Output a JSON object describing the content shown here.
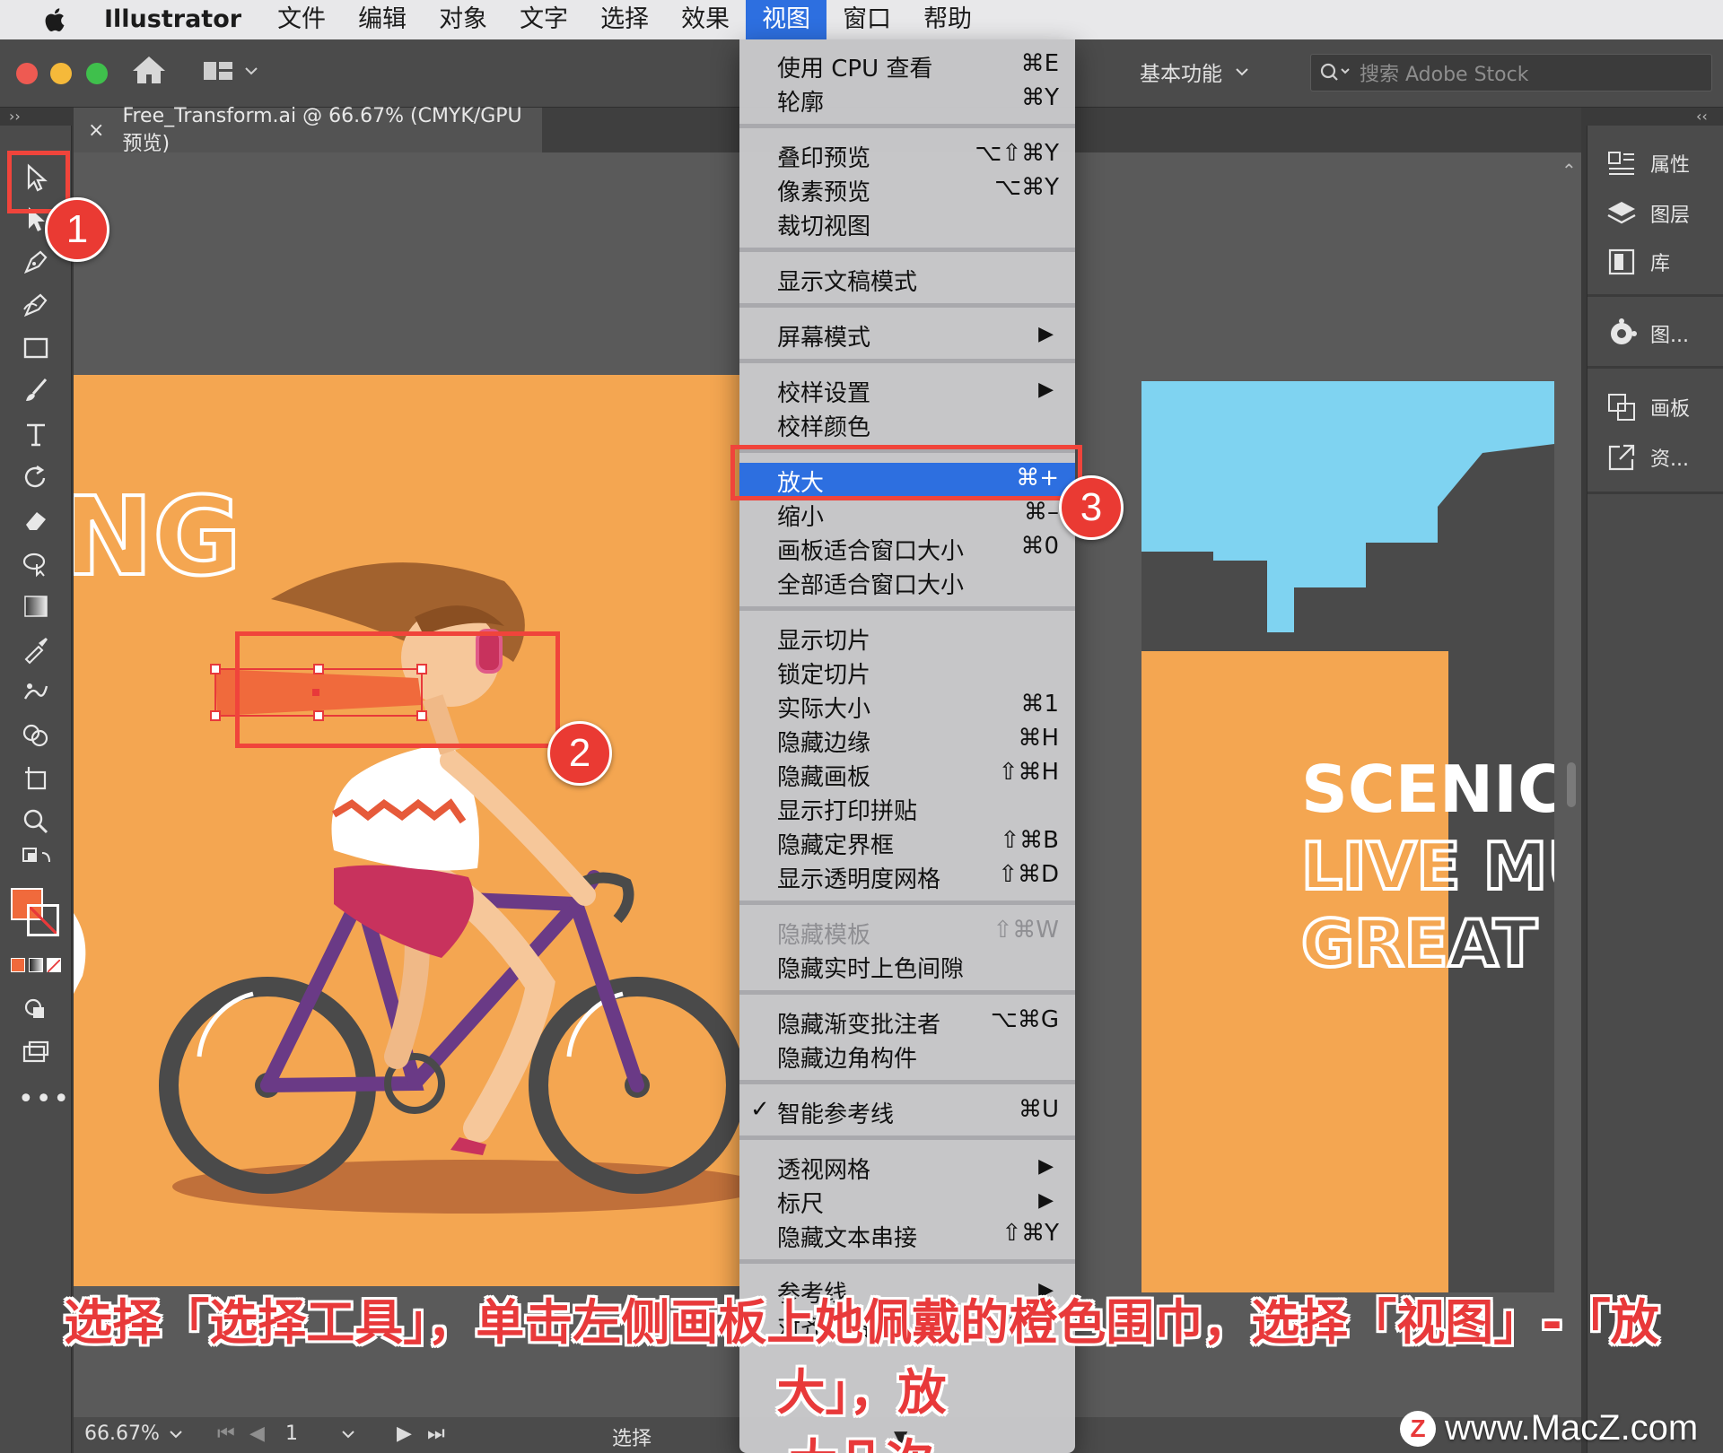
{
  "menubar": {
    "app": "Illustrator",
    "items": [
      "文件",
      "编辑",
      "对象",
      "文字",
      "选择",
      "效果",
      "视图",
      "窗口",
      "帮助"
    ],
    "active": "视图"
  },
  "appbar": {
    "workspace": "基本功能",
    "search_placeholder": "搜索 Adobe Stock"
  },
  "document_tab": {
    "close": "×",
    "title": "Free_Transform.ai @ 66.67% (CMYK/GPU 预览)"
  },
  "view_menu": [
    {
      "label": "使用 CPU 查看",
      "shortcut": "⌘E"
    },
    {
      "label": "轮廓",
      "shortcut": "⌘Y"
    },
    {
      "sep": true
    },
    {
      "label": "叠印预览",
      "shortcut": "⌥⇧⌘Y"
    },
    {
      "label": "像素预览",
      "shortcut": "⌥⌘Y"
    },
    {
      "label": "裁切视图",
      "shortcut": ""
    },
    {
      "sep": true
    },
    {
      "label": "显示文稿模式",
      "shortcut": ""
    },
    {
      "sep": true
    },
    {
      "label": "屏幕模式",
      "shortcut": "",
      "submenu": true
    },
    {
      "sep": true
    },
    {
      "label": "校样设置",
      "shortcut": "",
      "submenu": true
    },
    {
      "label": "校样颜色",
      "shortcut": ""
    },
    {
      "sep": true
    },
    {
      "label": "放大",
      "shortcut": "⌘+",
      "highlight": true
    },
    {
      "label": "缩小",
      "shortcut": "⌘–"
    },
    {
      "label": "画板适合窗口大小",
      "shortcut": "⌘0"
    },
    {
      "label": "全部适合窗口大小",
      "shortcut": ""
    },
    {
      "sep": true
    },
    {
      "label": "显示切片",
      "shortcut": ""
    },
    {
      "label": "锁定切片",
      "shortcut": ""
    },
    {
      "label": "实际大小",
      "shortcut": "⌘1"
    },
    {
      "label": "隐藏边缘",
      "shortcut": "⌘H"
    },
    {
      "label": "隐藏画板",
      "shortcut": "⇧⌘H"
    },
    {
      "label": "显示打印拼贴",
      "shortcut": ""
    },
    {
      "label": "隐藏定界框",
      "shortcut": "⇧⌘B"
    },
    {
      "label": "显示透明度网格",
      "shortcut": "⇧⌘D"
    },
    {
      "sep": true
    },
    {
      "label": "隐藏模板",
      "shortcut": "⇧⌘W",
      "disabled": true
    },
    {
      "label": "隐藏实时上色间隙",
      "shortcut": ""
    },
    {
      "sep": true
    },
    {
      "label": "隐藏渐变批注者",
      "shortcut": "⌥⌘G"
    },
    {
      "label": "隐藏边角构件",
      "shortcut": ""
    },
    {
      "sep": true
    },
    {
      "label": "智能参考线",
      "shortcut": "⌘U",
      "checked": true
    },
    {
      "sep": true
    },
    {
      "label": "透视网格",
      "shortcut": "",
      "submenu": true
    },
    {
      "label": "标尺",
      "shortcut": "",
      "submenu": true
    },
    {
      "label": "隐藏文本串接",
      "shortcut": "⇧⌘Y"
    },
    {
      "sep": true
    },
    {
      "label": "参考线",
      "shortcut": "",
      "submenu": true
    },
    {
      "label": "对齐网格",
      "shortcut": "⇧⌘\""
    }
  ],
  "right_panel": [
    {
      "icon": "properties-icon",
      "label": "属性"
    },
    {
      "icon": "layers-icon",
      "label": "图层"
    },
    {
      "icon": "libraries-icon",
      "label": "库"
    },
    {
      "icon": "appearance-icon",
      "label": "图..."
    },
    {
      "icon": "artboards-icon",
      "label": "画板"
    },
    {
      "icon": "asset-export-icon",
      "label": "资..."
    }
  ],
  "artwork": {
    "left_text": "NG",
    "right_lines": [
      "SCENIC",
      "LIVE MU",
      "GREAT"
    ]
  },
  "statusbar": {
    "zoom": "66.67%",
    "artboard": "1",
    "tool": "选择"
  },
  "annotations": {
    "badges": [
      "1",
      "2",
      "3"
    ],
    "caption_line1": "选择「选择工具」，单击左侧画板上她佩戴的橙色围巾，选择「视图」-「放大」，放",
    "caption_line2": "大几次"
  },
  "watermark": "www.MacZ.com",
  "colors": {
    "menu_highlight": "#2d6fe0",
    "annotation_red": "#ea3a33",
    "artboard_orange": "#f4a651",
    "sky_blue": "#7fd3f1",
    "fill_swatch": "#f06a3c"
  }
}
